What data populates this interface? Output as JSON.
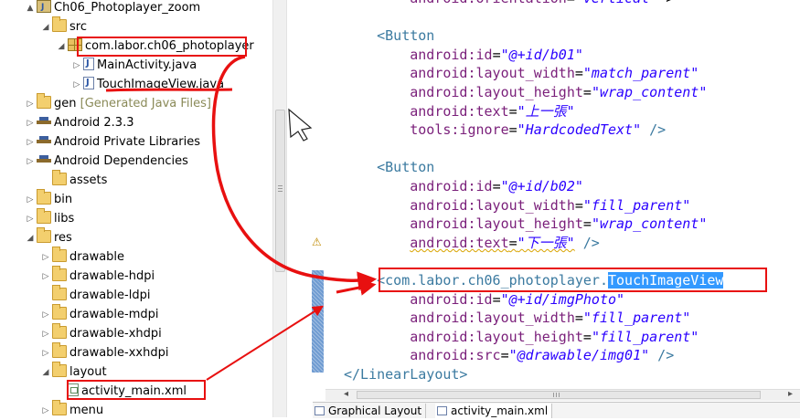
{
  "tree": {
    "items": [
      {
        "label": "Ch06_Photoplayer_zoom",
        "indent": 0,
        "twisty": "▲",
        "icon": "project"
      },
      {
        "label": "src",
        "indent": 1,
        "twisty": "◢",
        "icon": "folder"
      },
      {
        "label": "com.labor.ch06_photoplayer",
        "indent": 2,
        "twisty": "◢",
        "icon": "package"
      },
      {
        "label": "MainActivity.java",
        "indent": 3,
        "twisty": "▷",
        "icon": "java-file"
      },
      {
        "label": "TouchImageView.java",
        "indent": 3,
        "twisty": "▷",
        "icon": "java-file"
      },
      {
        "label": "gen",
        "extra": "[Generated Java Files]",
        "indent": 0,
        "twisty": "▷",
        "icon": "folder"
      },
      {
        "label": "Android 2.3.3",
        "indent": 0,
        "twisty": "▷",
        "icon": "library"
      },
      {
        "label": "Android Private Libraries",
        "indent": 0,
        "twisty": "▷",
        "icon": "library"
      },
      {
        "label": "Android Dependencies",
        "indent": 0,
        "twisty": "▷",
        "icon": "library"
      },
      {
        "label": "assets",
        "indent": 1,
        "twisty": "",
        "icon": "folder"
      },
      {
        "label": "bin",
        "indent": 0,
        "twisty": "▷",
        "icon": "folder"
      },
      {
        "label": "libs",
        "indent": 0,
        "twisty": "▷",
        "icon": "folder"
      },
      {
        "label": "res",
        "indent": 0,
        "twisty": "◢",
        "icon": "folder"
      },
      {
        "label": "drawable",
        "indent": 1,
        "twisty": "▷",
        "icon": "folder"
      },
      {
        "label": "drawable-hdpi",
        "indent": 1,
        "twisty": "▷",
        "icon": "folder"
      },
      {
        "label": "drawable-ldpi",
        "indent": 1,
        "twisty": "",
        "icon": "folder"
      },
      {
        "label": "drawable-mdpi",
        "indent": 1,
        "twisty": "▷",
        "icon": "folder"
      },
      {
        "label": "drawable-xhdpi",
        "indent": 1,
        "twisty": "▷",
        "icon": "folder"
      },
      {
        "label": "drawable-xxhdpi",
        "indent": 1,
        "twisty": "▷",
        "icon": "folder"
      },
      {
        "label": "layout",
        "indent": 1,
        "twisty": "◢",
        "icon": "folder"
      },
      {
        "label": "activity_main.xml",
        "indent": 2,
        "twisty": "",
        "icon": "xml-file"
      },
      {
        "label": "menu",
        "indent": 1,
        "twisty": "▷",
        "icon": "folder"
      }
    ]
  },
  "editor": {
    "lines": [
      [
        {
          "t": "        "
        },
        {
          "c": "attr",
          "t": "android:orientation"
        },
        {
          "c": "eq",
          "t": "="
        },
        {
          "c": "val",
          "t": "\"vertical\""
        },
        {
          "t": " >"
        }
      ],
      [
        {
          "t": ""
        }
      ],
      [
        {
          "t": "    "
        },
        {
          "c": "tag",
          "t": "<Button"
        }
      ],
      [
        {
          "t": "        "
        },
        {
          "c": "attr",
          "t": "android:id"
        },
        {
          "c": "eq",
          "t": "="
        },
        {
          "c": "val",
          "t": "\"@+id/b01\""
        }
      ],
      [
        {
          "t": "        "
        },
        {
          "c": "attr",
          "t": "android:layout_width"
        },
        {
          "c": "eq",
          "t": "="
        },
        {
          "c": "val",
          "t": "\"match_parent\""
        }
      ],
      [
        {
          "t": "        "
        },
        {
          "c": "attr",
          "t": "android:layout_height"
        },
        {
          "c": "eq",
          "t": "="
        },
        {
          "c": "val",
          "t": "\"wrap_content\""
        }
      ],
      [
        {
          "t": "        "
        },
        {
          "c": "attr",
          "t": "android:text"
        },
        {
          "c": "eq",
          "t": "="
        },
        {
          "c": "val",
          "t": "\"上一張\""
        }
      ],
      [
        {
          "t": "        "
        },
        {
          "c": "attr",
          "t": "tools:ignore"
        },
        {
          "c": "eq",
          "t": "="
        },
        {
          "c": "val",
          "t": "\"HardcodedText\""
        },
        {
          "c": "tag",
          "t": " />"
        }
      ],
      [
        {
          "t": ""
        }
      ],
      [
        {
          "t": "    "
        },
        {
          "c": "tag",
          "t": "<Button"
        }
      ],
      [
        {
          "t": "        "
        },
        {
          "c": "attr",
          "t": "android:id"
        },
        {
          "c": "eq",
          "t": "="
        },
        {
          "c": "val",
          "t": "\"@+id/b02\""
        }
      ],
      [
        {
          "t": "        "
        },
        {
          "c": "attr",
          "t": "android:layout_width"
        },
        {
          "c": "eq",
          "t": "="
        },
        {
          "c": "val",
          "t": "\"fill_parent\""
        }
      ],
      [
        {
          "t": "        "
        },
        {
          "c": "attr",
          "t": "android:layout_height"
        },
        {
          "c": "eq",
          "t": "="
        },
        {
          "c": "val",
          "t": "\"wrap_content\""
        }
      ],
      [
        {
          "t": "        "
        },
        {
          "c": "attr squig",
          "t": "android:text"
        },
        {
          "c": "eq squig",
          "t": "="
        },
        {
          "c": "val squig",
          "t": "\"下一張\""
        },
        {
          "c": "tag",
          "t": " />"
        }
      ],
      [
        {
          "t": ""
        }
      ],
      [
        {
          "t": "    "
        },
        {
          "c": "tag",
          "t": "<com.labor.ch06_photoplayer."
        },
        {
          "c": "tag sel-text",
          "t": "TouchImageView"
        }
      ],
      [
        {
          "t": "        "
        },
        {
          "c": "attr",
          "t": "android:id"
        },
        {
          "c": "eq",
          "t": "="
        },
        {
          "c": "val",
          "t": "\"@+id/imgPhoto\""
        }
      ],
      [
        {
          "t": "        "
        },
        {
          "c": "attr",
          "t": "android:layout_width"
        },
        {
          "c": "eq",
          "t": "="
        },
        {
          "c": "val",
          "t": "\"fill_parent\""
        }
      ],
      [
        {
          "t": "        "
        },
        {
          "c": "attr",
          "t": "android:layout_height"
        },
        {
          "c": "eq",
          "t": "="
        },
        {
          "c": "val",
          "t": "\"fill_parent\""
        }
      ],
      [
        {
          "t": "        "
        },
        {
          "c": "attr",
          "t": "android:src"
        },
        {
          "c": "eq",
          "t": "="
        },
        {
          "c": "val",
          "t": "\"@drawable/img01\""
        },
        {
          "c": "tag",
          "t": " />"
        }
      ],
      [
        {
          "c": "tag",
          "t": "</LinearLayout>"
        }
      ]
    ]
  },
  "hscroll": {
    "left_arrow": "◂",
    "right_arrow": "▸"
  },
  "tabs": [
    {
      "label": "Graphical Layout",
      "active": false
    },
    {
      "label": "activity_main.xml",
      "active": true
    }
  ],
  "markers": {
    "warning_glyph": "⚠"
  },
  "colors": {
    "annotation_red": "#e81010",
    "selection_blue": "#3399ff",
    "tag_color": "#3b7aa0",
    "attr_color": "#7a1f7a",
    "value_color": "#2a00ff"
  }
}
